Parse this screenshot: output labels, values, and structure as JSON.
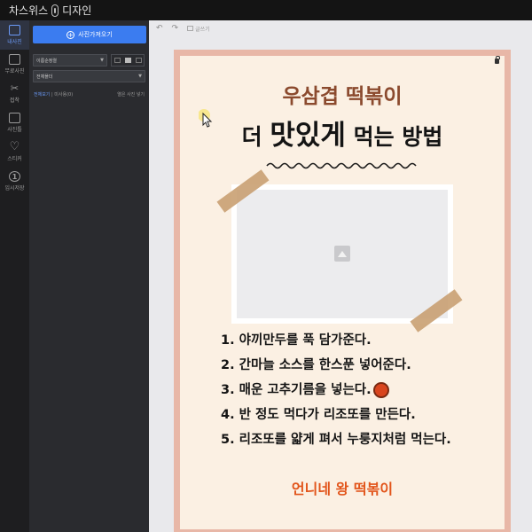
{
  "app": {
    "title": "차스위스",
    "subtitle": "디자인"
  },
  "rail": {
    "items": [
      {
        "label": "내사진",
        "active": true
      },
      {
        "label": "무료사진",
        "active": false
      },
      {
        "label": "접착",
        "active": false
      },
      {
        "label": "사진틀",
        "active": false
      },
      {
        "label": "스티커",
        "active": false
      },
      {
        "label": "임시저장",
        "icon_text": "1",
        "active": false
      }
    ]
  },
  "panel": {
    "upload_label": "사진가져오기",
    "sort_select": "이름순정렬",
    "album_select": "전체폴더",
    "filter_all": "전체보기",
    "filter_used": "미사용(0)",
    "filter_hide": "열은 사진 넣기"
  },
  "toolbar": {
    "undo": "↶",
    "redo": "↷",
    "label": "글쓰기"
  },
  "poster": {
    "subtitle": "우삼겹 떡볶이",
    "title_a": "더 ",
    "title_b": "맛있게",
    "title_c": " 먹는 방법",
    "steps": [
      "1. 야끼만두를 푹 담가준다.",
      "2. 간마늘 소스를 한스푼 넣어준다.",
      "3. 매운 고추기름을 넣는다.",
      "4. 반 정도 먹다가 리조또를 만든다.",
      "5. 리조또를 얇게 펴서 누룽지처럼 먹는다."
    ],
    "shop_name": "언니네 왕 떡볶이"
  },
  "colors": {
    "accent": "#3b7cf0",
    "poster_border": "#e8b7a7",
    "poster_bg": "#fbf0e3",
    "subtitle": "#8b4a2e",
    "shop_name": "#e2541a"
  }
}
